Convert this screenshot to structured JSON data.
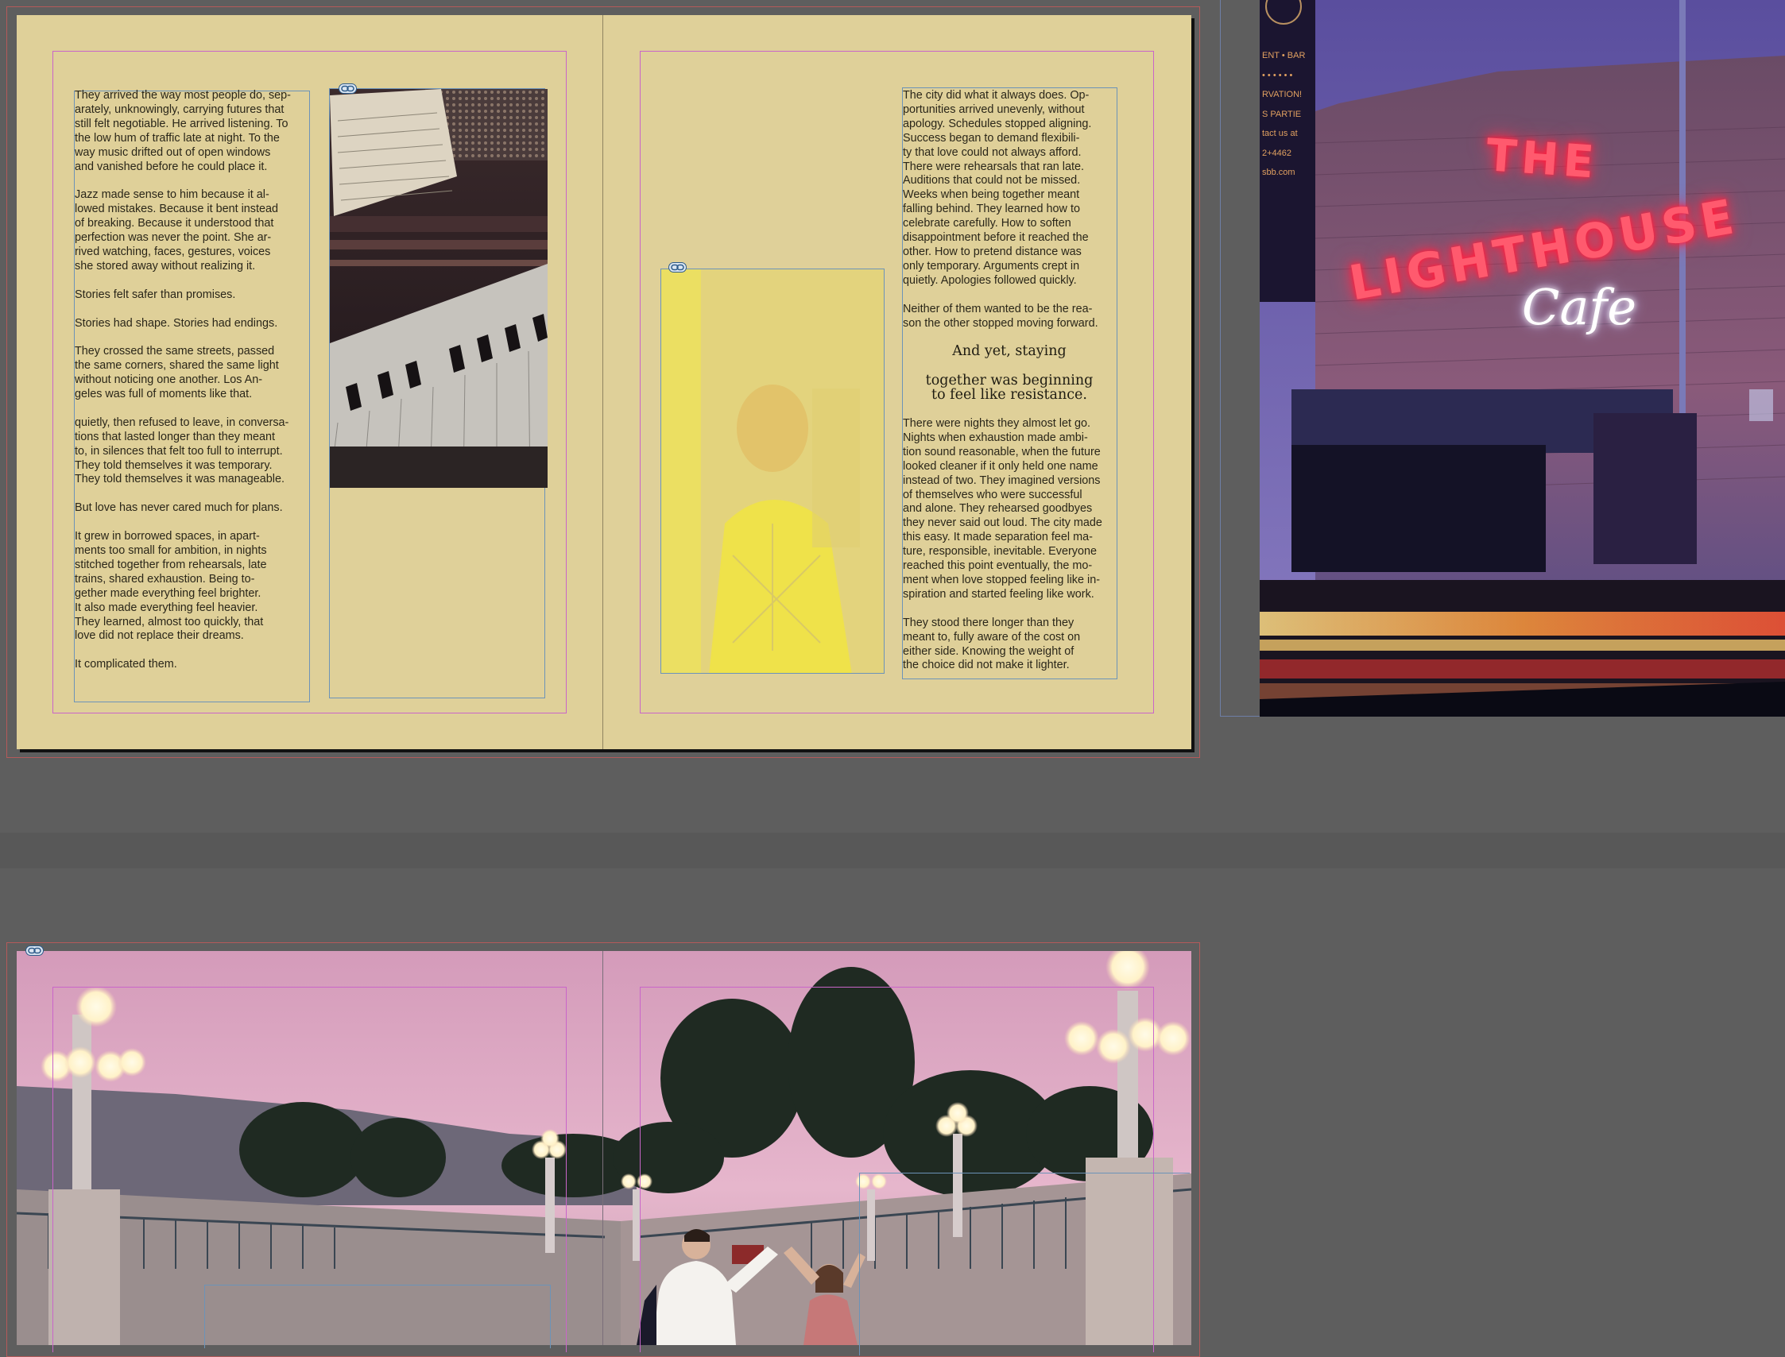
{
  "left_page": {
    "column_text": "They arrived the way most people do, sep-\narately, unknowingly, carrying futures that\nstill felt negotiable. He arrived listening. To\nthe low hum of traffic late at night. To the\nway music drifted out of open windows\nand vanished before he could place it.\n\nJazz made sense to him because it al-\nlowed mistakes. Because it bent instead\nof breaking. Because it understood that\nperfection was never the point. She ar-\nrived watching, faces, gestures, voices\nshe stored away without realizing it.\n\n Stories felt safer than promises.\n\n Stories had shape. Stories had endings.\n\nThey crossed the same streets, passed\nthe same corners, shared the same light\nwithout noticing one another. Los An-\ngeles was full of moments like that.\n\nquietly, then refused to leave, in conversa-\ntions that lasted longer than they meant\nto, in silences that felt too full to interrupt.\nThey told themselves it was temporary.\nThey told themselves it was manageable.\n\nBut love has never cared much for plans.\n\nIt grew in borrowed spaces, in apart-\nments too small for ambition, in nights\nstitched together from rehearsals, late\ntrains, shared exhaustion. Being to-\ngether made everything feel brighter.\nIt also made everything feel heavier.\nThey learned, almost too quickly, that\nlove did not replace their dreams.\n\nIt complicated them."
  },
  "right_page": {
    "column_text_top": "The city did what it always does. Op-\nportunities arrived unevenly, without\napology. Schedules stopped aligning.\nSuccess began to demand flexibili-\nty that love could not always afford.\nThere were rehearsals that ran late.\nAuditions that could not be missed.\nWeeks when being together meant\nfalling behind. They learned how to\ncelebrate carefully. How to soften\ndisappointment before it reached the\nother. How to pretend distance was\nonly temporary. Arguments crept in\nquietly. Apologies followed quickly.\n\nNeither of them wanted to be the rea-\nson the other stopped moving forward.",
    "pull_quote_line1": "And yet, staying",
    "pull_quote_line2": "together was beginning",
    "pull_quote_line3": "to feel like resistance.",
    "column_text_bottom": "There were nights they almost let go.\nNights when exhaustion made ambi-\ntion sound reasonable, when the future\nlooked cleaner if it only held one name\ninstead of two. They imagined versions\nof themselves who were successful\nand alone. They rehearsed goodbyes\nthey never said out loud. The city made\nthis easy. It made separation feel ma-\nture, responsible, inevitable. Everyone\nreached this point eventually, the mo-\nment when love stopped feeling like in-\nspiration and started feeling like work.\n\nThey stood there longer than they\nmeant to, fully aware of the cost on\neither side. Knowing the weight of\nthe choice did not make it lighter."
  },
  "pasteboard_image": {
    "sign_line1": "THE",
    "sign_line2": "LIGHTHOUSE",
    "sign_script": "Cafe",
    "sidebar_text": [
      "ENT • BAR",
      "• • • • • •",
      "RVATION!",
      "S PARTIE",
      "tact us at",
      "2+4462",
      "sbb.com"
    ]
  },
  "icons": {
    "link": "link-icon"
  },
  "colors": {
    "page": "#dfd099",
    "pasteboard": "#5e5e5e",
    "margin_guide": "#c965c9",
    "frame": "#6c93b8"
  }
}
